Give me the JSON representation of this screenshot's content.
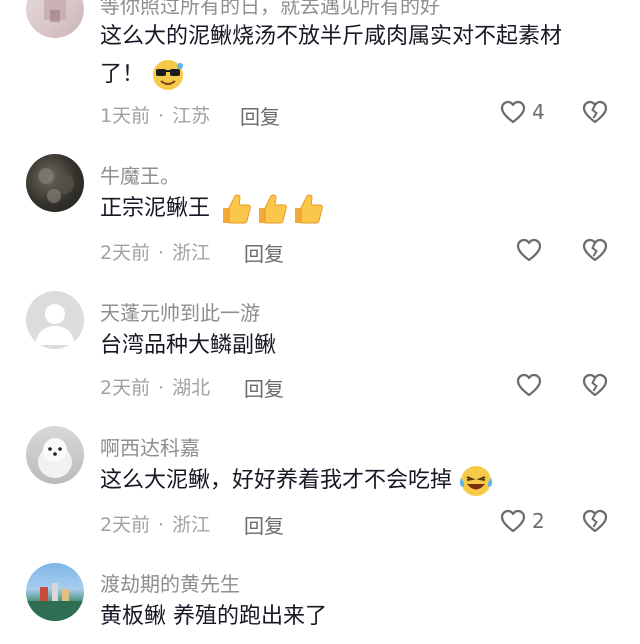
{
  "comments": [
    {
      "username": "等你照过所有的日，就去遇见所有的好",
      "text_line1": "这么大的泥鳅烧汤不放半斤咸肉属实对不起素材",
      "text_line2": "了！",
      "time": "1天前",
      "location": "江苏",
      "reply": "回复",
      "likes": "4",
      "emoji": "cool-face-emoji"
    },
    {
      "username": "牛魔王。",
      "text": "正宗泥鳅王",
      "time": "2天前",
      "location": "浙江",
      "reply": "回复",
      "likes": "",
      "emoji": "thumbs-up-emoji"
    },
    {
      "username": "天蓬元帅到此一游",
      "text": "台湾品种大鳞副鳅",
      "time": "2天前",
      "location": "湖北",
      "reply": "回复",
      "likes": ""
    },
    {
      "username": "啊西达科嘉",
      "text": "这么大泥鳅，好好养着我才不会吃掉",
      "time": "2天前",
      "location": "浙江",
      "reply": "回复",
      "likes": "2",
      "emoji": "laughing-tears-emoji"
    },
    {
      "username": "渡劫期的黄先生",
      "text": "黄板鳅  养殖的跑出来了"
    }
  ],
  "separator": "·",
  "colors": {
    "username": "#8e8e93",
    "text": "#161823",
    "meta": "#a1a1a6",
    "icon": "#6b6b70"
  }
}
